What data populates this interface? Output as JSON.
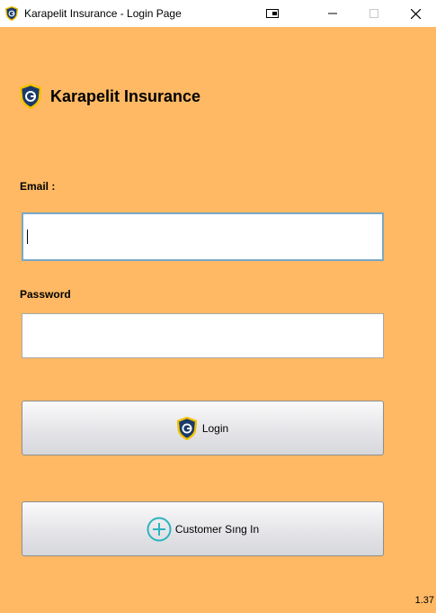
{
  "window": {
    "title": "Karapelit Insurance - Login Page"
  },
  "brand": {
    "name": "Karapelit Insurance"
  },
  "form": {
    "email_label": "Email :",
    "email_value": "",
    "password_label": "Password",
    "password_value": ""
  },
  "buttons": {
    "login": "Login",
    "customer_signin": "Customer Sıng In"
  },
  "footer": {
    "version": "1.37"
  },
  "colors": {
    "background": "#ffb964",
    "shield": "#1a3a6b",
    "shield_border": "#f2c200",
    "plus": "#2bb3c0"
  }
}
